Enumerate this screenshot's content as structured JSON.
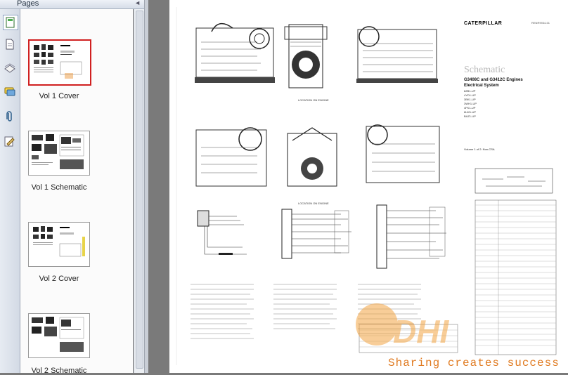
{
  "panel": {
    "title": "Pages",
    "collapse_glyph": "◄"
  },
  "toolstrip": {
    "tools": [
      {
        "name": "pages-tool-icon"
      },
      {
        "name": "document-tool-icon"
      },
      {
        "name": "layers-tool-icon"
      },
      {
        "name": "comments-tool-icon"
      },
      {
        "name": "attachments-tool-icon"
      },
      {
        "name": "signatures-tool-icon"
      }
    ]
  },
  "thumbnails": [
    {
      "label": "Vol 1 Cover",
      "selected": true
    },
    {
      "label": "Vol 1 Schematic",
      "selected": false
    },
    {
      "label": "Vol 2 Cover",
      "selected": false
    },
    {
      "label": "Vol 2 Schematic",
      "selected": false
    }
  ],
  "document": {
    "brand": "CATERPILLAR",
    "pub_no": "RENR9934-01",
    "heading": "Schematic",
    "engines_line1": "G3408C and G3412C Engines",
    "engines_line2": "Electrical System",
    "serials": [
      "8ZB1-UP",
      "4YD1-UP",
      "3BK1-UP",
      "3WH1-UP",
      "4FK1-UP",
      "6LW1-UP",
      "BAZ1-UP"
    ],
    "volume": "Volume 1 of 2: Non-CSA",
    "location_label_1": "LOCATION ON ENGINE",
    "location_label_2": "LOCATION ON ENGINE"
  },
  "watermark": "Sharing creates success",
  "colors": {
    "selected_border": "#d02020",
    "watermark": "#e07a20"
  }
}
